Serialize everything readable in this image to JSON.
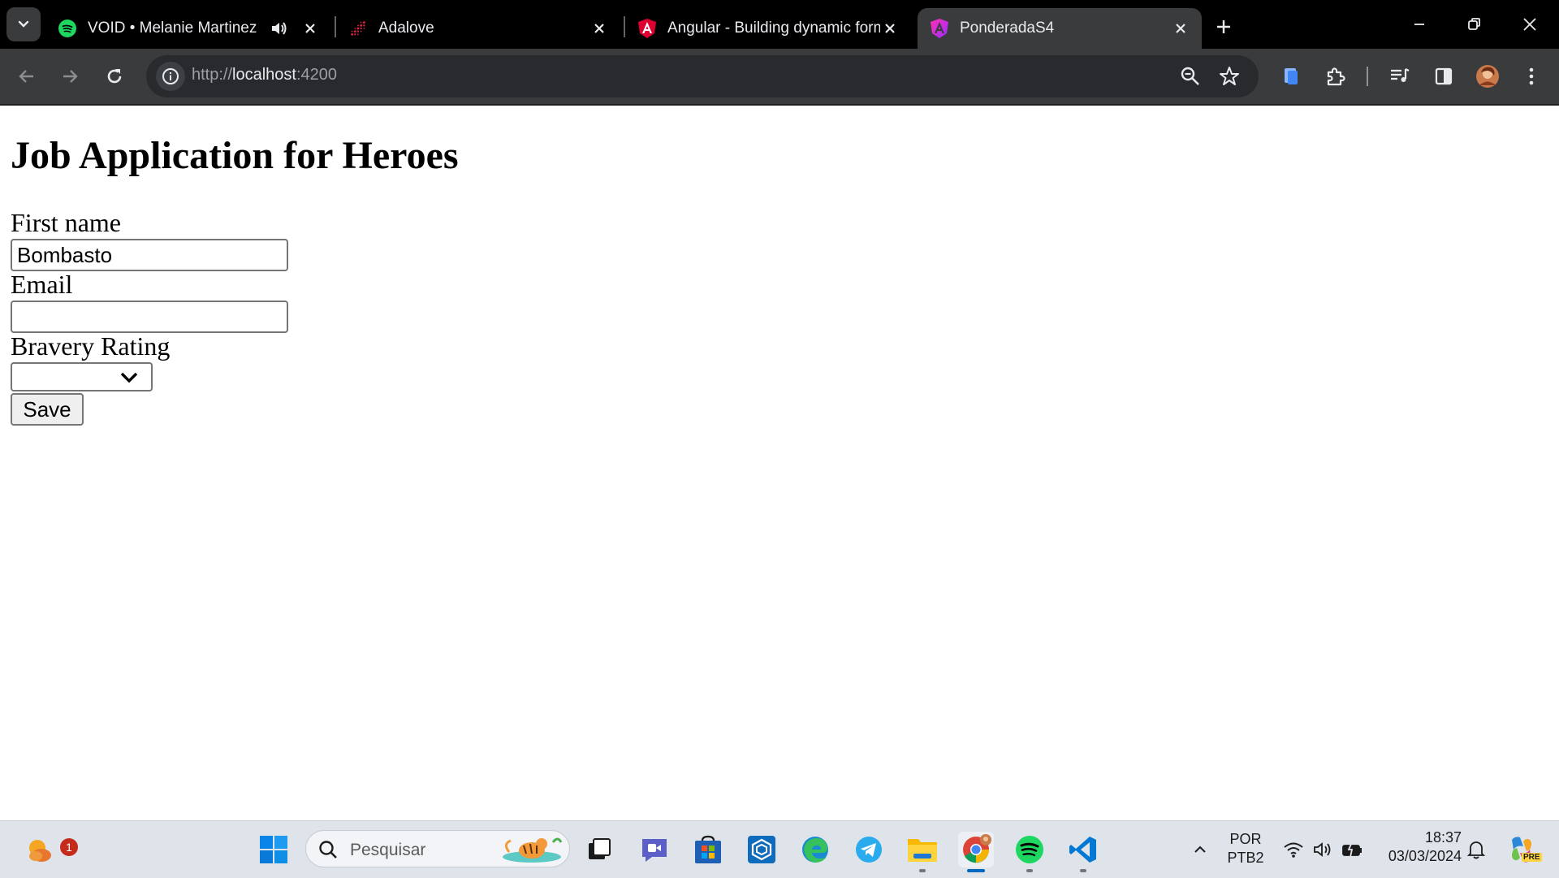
{
  "browser": {
    "tabs": [
      {
        "title": "VOID • Melanie Martinez",
        "favicon": "spotify-icon",
        "audio": true,
        "active": false
      },
      {
        "title": "Adalove",
        "favicon": "adalove-icon",
        "audio": false,
        "active": false
      },
      {
        "title": "Angular - Building dynamic forms",
        "favicon": "angular-icon",
        "audio": false,
        "active": false
      },
      {
        "title": "PonderadaS4",
        "favicon": "angular-gradient-icon",
        "audio": false,
        "active": true
      }
    ],
    "address": {
      "scheme": "http://",
      "host": "localhost",
      "port": ":4200"
    }
  },
  "page": {
    "heading": "Job Application for Heroes",
    "fields": [
      {
        "label": "First name",
        "value": "Bombasto"
      },
      {
        "label": "Email",
        "value": ""
      },
      {
        "label": "Bravery Rating",
        "value": ""
      }
    ],
    "save_label": "Save"
  },
  "taskbar": {
    "weather_badge": "1",
    "search_placeholder": "Pesquisar",
    "language": "POR",
    "layout": "PTB2",
    "time": "18:37",
    "date": "03/03/2024",
    "copilot_badge": "PRE"
  },
  "colors": {
    "chrome_dark": "#000000",
    "toolbar": "#3a3b3d",
    "omnibox": "#282a2d",
    "taskbar": "#dfe3ea",
    "spotify_green": "#1ed760",
    "angular_red": "#dd0031",
    "vscode_blue": "#0078d4"
  }
}
